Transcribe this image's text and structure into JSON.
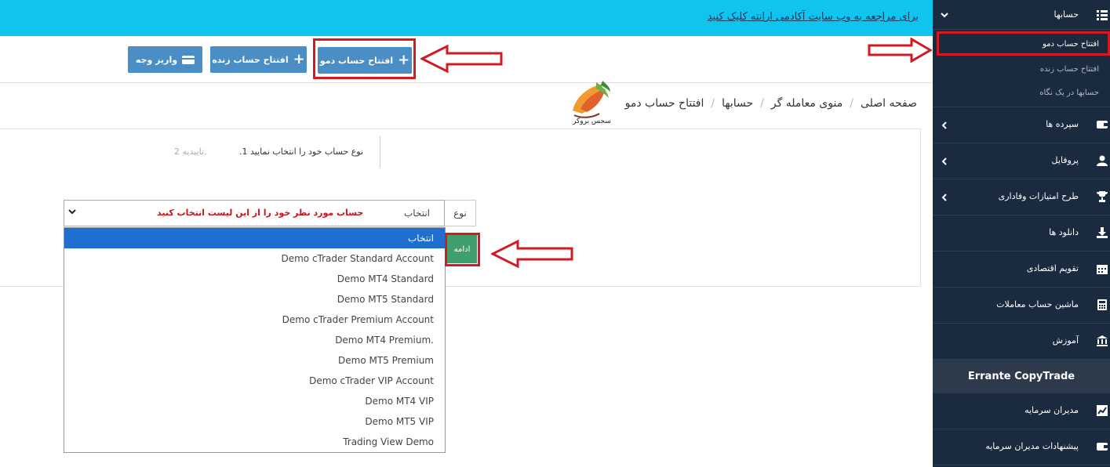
{
  "banner": {
    "link_text": "برای مراجعه به وب سایت آکادمی ارانته کلیک کنید"
  },
  "toolbar": {
    "deposit_label": "واریز وجه",
    "open_live_label": "افتتاح حساب زنده",
    "open_demo_label": "افتتاح حساب دمو"
  },
  "breadcrumb": {
    "items": [
      "صفحه اصلی",
      "منوی معامله گر",
      "حسابها",
      "افتتاح حساب دمو"
    ]
  },
  "logo": {
    "text": "سجس بروکر"
  },
  "wizard": {
    "step1": "نوع حساب خود را انتخاب نمایید 1.",
    "step2": "تاییدیه 2.",
    "type_label": "نوع",
    "select_value": "انتخاب",
    "annotation": "حساب مورد نظر خود را از این لیست انتخاب کنید",
    "continue_label": "ادامه",
    "options": [
      "انتخاب",
      "Demo cTrader Standard Account",
      "Demo MT4 Standard",
      "Demo MT5 Standard",
      "Demo cTrader Premium Account",
      "Demo MT4 Premium.",
      "Demo MT5 Premium",
      "Demo cTrader VIP Account",
      "Demo MT4 VIP",
      "Demo MT5 VIP",
      "Trading View Demo"
    ]
  },
  "sidebar": {
    "accounts": "حسابها",
    "sub_items": [
      "افتتاح حساب دمو",
      "افتتاح حساب زنده",
      "حسابها در یک نگاه"
    ],
    "items": [
      {
        "label": "سپرده ها",
        "icon": "wallet-icon"
      },
      {
        "label": "پروفایل",
        "icon": "user-icon"
      },
      {
        "label": "طرح امتیازات وفاداری",
        "icon": "trophy-icon"
      },
      {
        "label": "دانلود ها",
        "icon": "download-icon"
      },
      {
        "label": "تقویم اقتصادی",
        "icon": "calendar-icon"
      },
      {
        "label": "ماشین حساب معاملات",
        "icon": "calculator-icon"
      },
      {
        "label": "آموزش",
        "icon": "bank-icon"
      }
    ],
    "copytrade": "Errante CopyTrade",
    "bottom_items": [
      {
        "label": "مدیران سرمایه",
        "icon": "chart-icon"
      },
      {
        "label": "پیشنهادات مدیران سرمایه",
        "icon": "wallet-icon"
      }
    ]
  },
  "colors": {
    "banner": "#0fc4ee",
    "button": "#4a8ec5",
    "sidebar": "#1b2b3f",
    "highlight_red": "#d11a24",
    "continue": "#3fa06d",
    "selected_option": "#1f6fd0"
  }
}
